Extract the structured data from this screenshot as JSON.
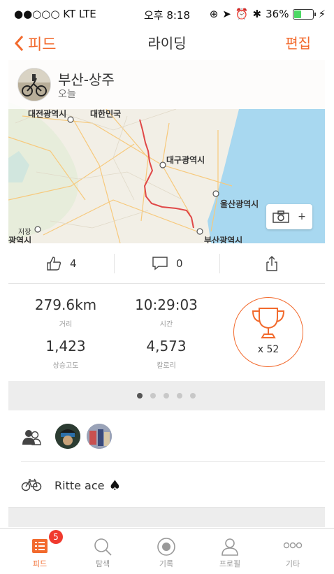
{
  "status_bar": {
    "carrier": "●●○○○ KT  LTE",
    "time": "오후 8:18",
    "battery": "36%",
    "battery_level": 0.36
  },
  "nav": {
    "back_label": "피드",
    "title": "라이딩",
    "edit_label": "편집"
  },
  "activity": {
    "name": "부산-상주",
    "date": "오늘"
  },
  "map": {
    "labels": [
      "대전광역시",
      "대한민국",
      "대구광역시",
      "울산광역시",
      "부산광역시",
      "저장",
      "광역시"
    ],
    "camera_plus": "+"
  },
  "social": {
    "kudos_count": "4",
    "comment_count": "0"
  },
  "stats": {
    "distance": {
      "value": "279.6km",
      "label": "거리"
    },
    "time": {
      "value": "10:29:03",
      "label": "시간"
    },
    "elevation": {
      "value": "1,423",
      "label": "상승고도"
    },
    "calories": {
      "value": "4,573",
      "label": "칼로리"
    },
    "trophy_count": "x 52"
  },
  "pager": {
    "count": 5,
    "active": 0
  },
  "gear": {
    "bike_name": "Ritte ace",
    "bike_suffix": "♠"
  },
  "tabbar": {
    "badge": "5",
    "items": [
      {
        "label": "피드"
      },
      {
        "label": "탐색"
      },
      {
        "label": "기록"
      },
      {
        "label": "프로필"
      },
      {
        "label": "기타"
      }
    ]
  },
  "colors": {
    "accent": "#f26a2d",
    "sea": "#a8d8f0",
    "route": "#e04848"
  }
}
